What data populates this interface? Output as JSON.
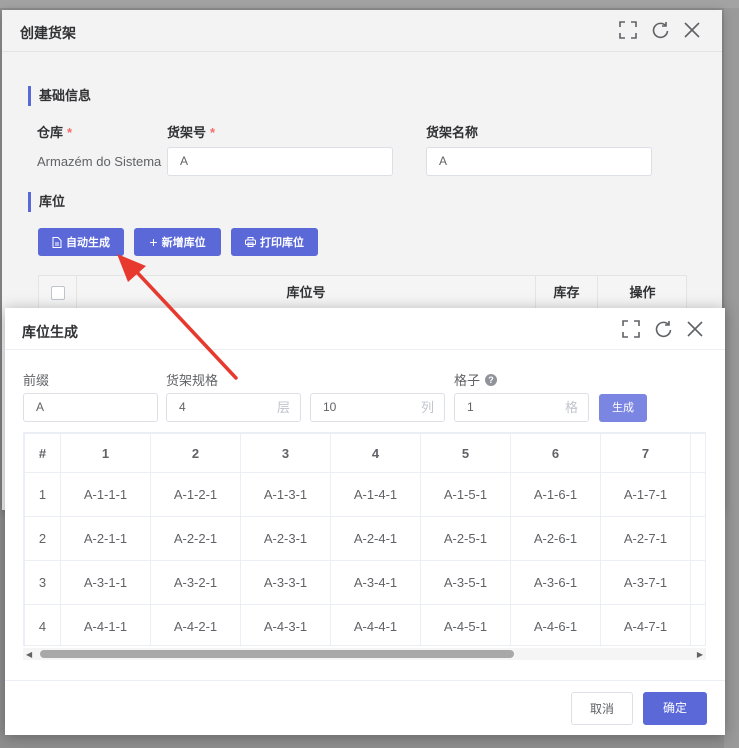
{
  "back_dialog": {
    "title": "创建货架",
    "section_basic": "基础信息",
    "warehouse_label": "仓库",
    "warehouse_value": "Armazém do Sistema",
    "shelf_no_label": "货架号",
    "shelf_no_value": "A",
    "shelf_name_label": "货架名称",
    "shelf_name_value": "A",
    "section_location": "库位",
    "btn_auto": "自动生成",
    "btn_add": "新增库位",
    "btn_print": "打印库位",
    "col_location": "库位号",
    "col_stock": "库存",
    "col_action": "操作"
  },
  "front_dialog": {
    "title": "库位生成",
    "prefix_label": "前缀",
    "prefix_value": "A",
    "spec_label": "货架规格",
    "layers_value": "4",
    "layers_unit": "层",
    "columns_value": "10",
    "columns_unit": "列",
    "cell_label": "格子",
    "cell_value": "1",
    "cell_unit": "格",
    "generate_button": "生成",
    "table": {
      "headers": [
        "#",
        "1",
        "2",
        "3",
        "4",
        "5",
        "6",
        "7"
      ],
      "rows": [
        [
          "1",
          "A-1-1-1",
          "A-1-2-1",
          "A-1-3-1",
          "A-1-4-1",
          "A-1-5-1",
          "A-1-6-1",
          "A-1-7-1"
        ],
        [
          "2",
          "A-2-1-1",
          "A-2-2-1",
          "A-2-3-1",
          "A-2-4-1",
          "A-2-5-1",
          "A-2-6-1",
          "A-2-7-1"
        ],
        [
          "3",
          "A-3-1-1",
          "A-3-2-1",
          "A-3-3-1",
          "A-3-4-1",
          "A-3-5-1",
          "A-3-6-1",
          "A-3-7-1"
        ],
        [
          "4",
          "A-4-1-1",
          "A-4-2-1",
          "A-4-3-1",
          "A-4-4-1",
          "A-4-5-1",
          "A-4-6-1",
          "A-4-7-1"
        ]
      ]
    },
    "cancel_button": "取消",
    "confirm_button": "确定"
  },
  "colors": {
    "primary": "#5b68d8",
    "arrow": "#e8392f",
    "required": "#f56c6c"
  },
  "icons": [
    "fullscreen-icon",
    "refresh-icon",
    "close-icon",
    "document-icon",
    "plus-icon",
    "printer-icon",
    "help-icon"
  ]
}
